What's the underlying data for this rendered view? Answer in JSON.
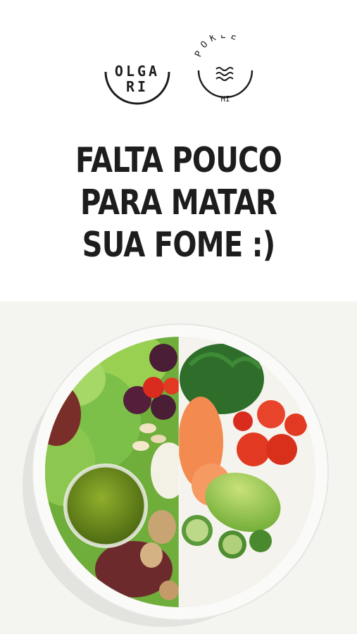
{
  "logos": {
    "olga": {
      "line1": "OLGA",
      "line2": "RI"
    },
    "pokee": {
      "arc_text": "POKEE",
      "bottom_text": "HI"
    }
  },
  "headline": {
    "line1": "FALTA POUCO",
    "line2": "PARA MATAR",
    "line3": "SUA FOME :)"
  },
  "colors": {
    "text": "#1d1d1d",
    "photo_bg": "#f4f4f1",
    "lettuce": "#7cc04a",
    "tomato": "#e23a22",
    "salmon": "#f38a4f",
    "avocado": "#8fc24a",
    "seaweed": "#2e6e2a",
    "dressing": "#6f8d1f"
  }
}
